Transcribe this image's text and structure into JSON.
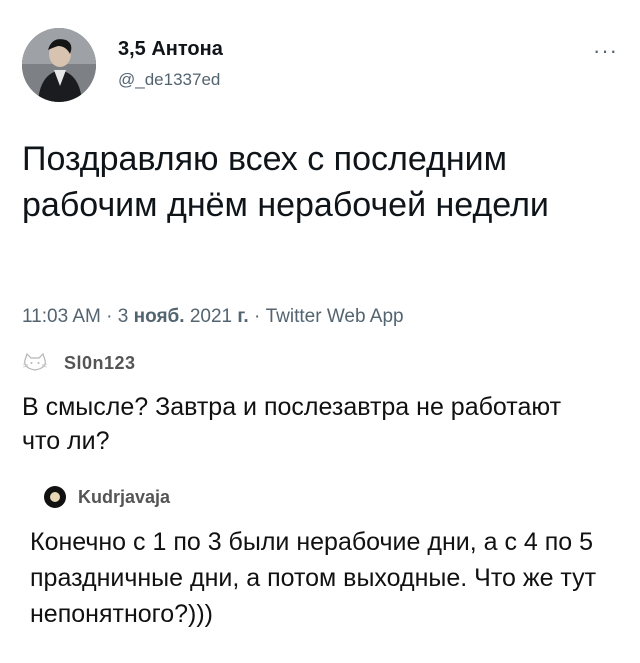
{
  "tweet": {
    "display_name": "3,5 Антона",
    "username": "@_de1337ed",
    "more_icon": "more-dots-icon",
    "text": "Поздравляю всех с последним рабочим днём нерабочей недели",
    "time": "11:03 AM",
    "date_day": "3",
    "date_month": "нояб.",
    "date_year": "2021",
    "date_year_suffix": "г.",
    "sep": "·",
    "source": "Twitter Web App"
  },
  "comments": [
    {
      "username": "Sl0n123",
      "avatar_icon": "cat-avatar-icon",
      "text": "В смысле? Завтра и послезавтра не работают что ли?"
    },
    {
      "username": "Kudrjavaja",
      "avatar_icon": "round-avatar-icon",
      "text": "Конечно с 1 по 3 были нерабочие дни, а с 4 по 5 праздничные дни, а потом выходные. Что же тут непонятного?)))"
    }
  ]
}
